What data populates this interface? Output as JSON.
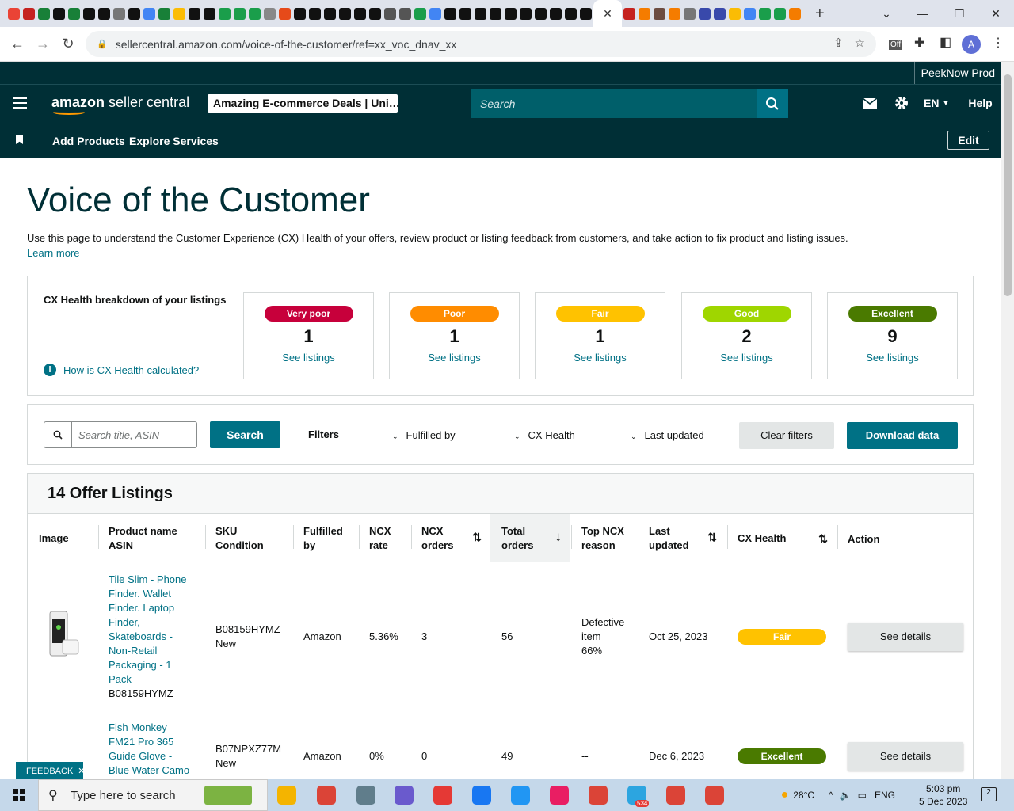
{
  "browser": {
    "url": "sellercentral.amazon.com/voice-of-the-customer/ref=xx_voc_dnav_xx",
    "profile_initial": "A",
    "extension_badge": "Off",
    "tab_close": "✕",
    "new_tab": "+"
  },
  "seller": {
    "account_name": "PeekNow Prod",
    "logo_prefix": "amazon",
    "logo_suffix": " seller central",
    "store": "Amazing E-commerce Deals | Uni…",
    "search_placeholder": "Search",
    "language": "EN",
    "help": "Help",
    "subnav": [
      "Add Products",
      "Explore Services"
    ],
    "edit": "Edit"
  },
  "page": {
    "title": "Voice of the Customer",
    "intro": "Use this page to understand the Customer Experience (CX) Health of your offers, review product or listing feedback from customers, and take action to fix product and listing issues.",
    "learn_more": "Learn more"
  },
  "cx_breakdown": {
    "title": "CX Health breakdown of your listings",
    "how_link": "How is CX Health calculated?",
    "cards": [
      {
        "label": "Very poor",
        "count": "1",
        "link": "See listings",
        "color": "#c7003b",
        "text": "#ffffff"
      },
      {
        "label": "Poor",
        "count": "1",
        "link": "See listings",
        "color": "#ff8c00",
        "text": "#ffffff"
      },
      {
        "label": "Fair",
        "count": "1",
        "link": "See listings",
        "color": "#ffc200",
        "text": "#ffffff"
      },
      {
        "label": "Good",
        "count": "2",
        "link": "See listings",
        "color": "#9fd600",
        "text": "#ffffff"
      },
      {
        "label": "Excellent",
        "count": "9",
        "link": "See listings",
        "color": "#4a7a00",
        "text": "#ffffff"
      }
    ]
  },
  "filters": {
    "search_placeholder": "Search title, ASIN",
    "search_button": "Search",
    "label": "Filters",
    "dropdowns": [
      "Fulfilled by",
      "CX Health",
      "Last updated"
    ],
    "clear": "Clear filters",
    "download": "Download data"
  },
  "table": {
    "title": "14 Offer Listings",
    "headers": {
      "image": "Image",
      "product": [
        "Product name",
        "ASIN"
      ],
      "sku": [
        "SKU",
        "Condition"
      ],
      "fulfilled": [
        "Fulfilled",
        "by"
      ],
      "ncx_rate": [
        "NCX",
        "rate"
      ],
      "ncx_orders": [
        "NCX",
        "orders"
      ],
      "total_orders": [
        "Total",
        "orders"
      ],
      "top_reason": [
        "Top NCX",
        "reason"
      ],
      "last_updated": [
        "Last",
        "updated"
      ],
      "cx_health": "CX Health",
      "action": "Action"
    },
    "rows": [
      {
        "product_lines": [
          "Tile Slim - Phone",
          "Finder. Wallet",
          "Finder. Laptop",
          "Finder,",
          "Skateboards -",
          "Non-Retail",
          "Packaging - 1",
          "Pack"
        ],
        "asin": "B08159HYMZ",
        "sku": "B08159HYMZ",
        "condition": "New",
        "fulfilled_by": "Amazon",
        "ncx_rate": "5.36%",
        "ncx_orders": "3",
        "total_orders": "56",
        "reason_lines": [
          "Defective",
          "item",
          "66%"
        ],
        "last_updated": "Oct 25, 2023",
        "cx_health": "Fair",
        "cx_color": "#ffc200",
        "action": "See details"
      },
      {
        "product_lines": [
          "Fish Monkey",
          "FM21 Pro 365",
          "Guide Glove -",
          "Blue Water Camo"
        ],
        "sku": "B07NPXZ77M",
        "condition": "New",
        "fulfilled_by": "Amazon",
        "ncx_rate": "0%",
        "ncx_orders": "0",
        "total_orders": "49",
        "reason": "--",
        "last_updated": "Dec 6, 2023",
        "cx_health": "Excellent",
        "cx_color": "#4a7a00",
        "action": "See details"
      }
    ]
  },
  "feedback": "FEEDBACK",
  "taskbar": {
    "search": "Type here to search",
    "temp": "28°C",
    "lang": "ENG",
    "time": "5:03 pm",
    "date": "5 Dec 2023",
    "notifications": "2",
    "telegram_badge": "534"
  }
}
